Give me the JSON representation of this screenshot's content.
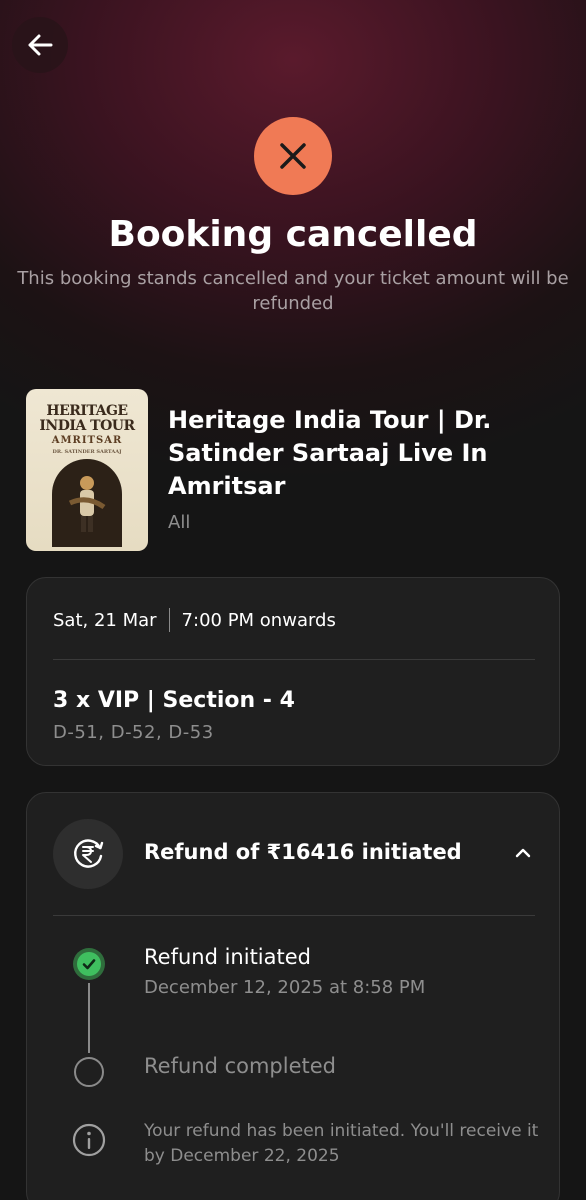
{
  "header": {
    "back_icon": "arrow-left-icon",
    "status_icon": "close-icon",
    "status_color": "#f07a55",
    "title": "Booking cancelled",
    "subtitle": "This booking stands cancelled and your ticket amount will be refunded"
  },
  "event": {
    "poster": {
      "line1": "HERITAGE",
      "line2": "INDIA TOUR",
      "line3": "AMRITSAR",
      "line4": "DR. SATINDER SARTAAJ"
    },
    "title": "Heritage India Tour | Dr. Satinder Sartaaj Live In Amritsar",
    "tag": "All"
  },
  "booking": {
    "date": "Sat, 21 Mar",
    "time": "7:00 PM onwards",
    "seat_type": "3 x VIP | Section - 4",
    "seats": "D-51, D-52, D-53"
  },
  "refund": {
    "icon": "rupee-refund-icon",
    "title": "Refund of ₹16416 initiated",
    "chevron_icon": "chevron-up-icon",
    "steps": [
      {
        "title": "Refund initiated",
        "date": "December 12, 2025 at 8:58 PM",
        "status": "done",
        "status_color": "#3fbf5f"
      },
      {
        "title": "Refund completed",
        "status": "pending"
      }
    ],
    "info_icon": "info-icon",
    "info_text": "Your refund has been initiated. You'll receive it by December 22, 2025"
  }
}
